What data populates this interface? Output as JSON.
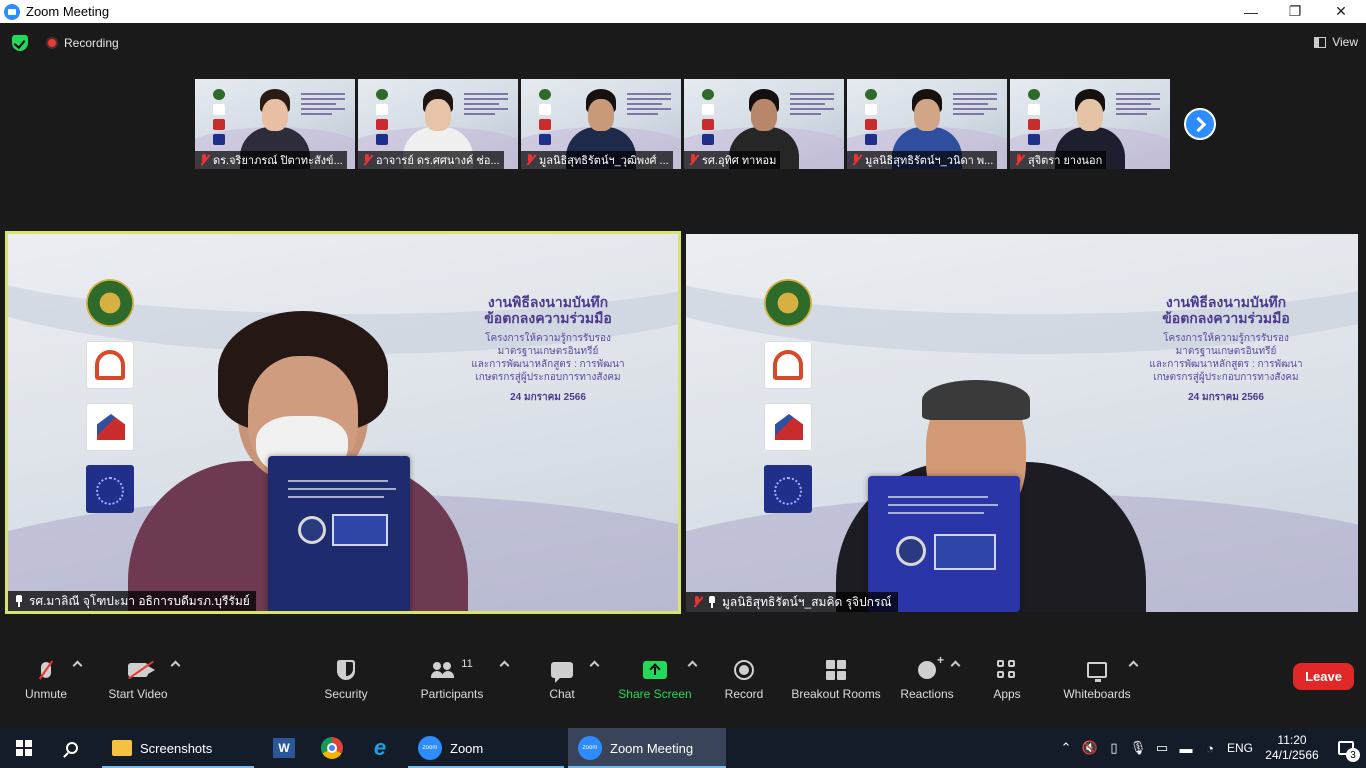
{
  "window": {
    "title": "Zoom Meeting",
    "minimize": "—",
    "maximize": "❐",
    "close": "✕"
  },
  "topbar": {
    "recording_label": "Recording",
    "view_label": "View"
  },
  "thumbnails": [
    {
      "name": "ดร.จริยาภรณ์ ปิตาทะสังข์...",
      "skin": "#e8bfa2",
      "hair": "#2a1b14",
      "shirt": "#2c2c3a"
    },
    {
      "name": "อาจารย์ ดร.ศศนางค์ ช่อ...",
      "skin": "#e7c3a8",
      "hair": "#1d1512",
      "shirt": "#f0f0f0"
    },
    {
      "name": "มูลนิธิสุทธิรัตน์ฯ_วุฒิพงศ์ ...",
      "skin": "#c99a7a",
      "hair": "#161010",
      "shirt": "#1e2a4a"
    },
    {
      "name": "รศ.อุทิศ ทาหอม",
      "skin": "#b8876a",
      "hair": "#141010",
      "shirt": "#262626"
    },
    {
      "name": "มูลนิธิสุทธิรัตน์ฯ_วนิดา พ...",
      "skin": "#d1a687",
      "hair": "#16110f",
      "shirt": "#2f4ea0"
    },
    {
      "name": "สุจิตรา  ยางนอก",
      "skin": "#e5c3a5",
      "hair": "#141010",
      "shirt": "#1d1f2e"
    }
  ],
  "main_videos": [
    {
      "name": "รศ.มาลิณี จุโฑปะมา อธิการบดีมรภ.บุรีรัมย์",
      "active": true,
      "muted": false
    },
    {
      "name": "มูลนิธิสุทธิรัตน์ฯ_สมคิด รุจิปกรณ์",
      "active": false,
      "muted": true
    }
  ],
  "slide": {
    "title_line1": "งานพิธีลงนามบันทึก",
    "title_line2": "ข้อตกลงความร่วมมือ",
    "body_line1": "โครงการให้ความรู้การรับรอง",
    "body_line2": "มาตรฐานเกษตรอินทรีย์",
    "body_line3": "และการพัฒนาหลักสูตร : การพัฒนา",
    "body_line4": "เกษตรกรสู่ผู้ประกอบการทางสังคม",
    "date": "24 มกราคม 2566"
  },
  "toolbar": {
    "unmute": "Unmute",
    "start_video": "Start Video",
    "security": "Security",
    "participants": "Participants",
    "participants_count": "11",
    "chat": "Chat",
    "share_screen": "Share Screen",
    "record": "Record",
    "breakout_rooms": "Breakout Rooms",
    "reactions": "Reactions",
    "apps": "Apps",
    "whiteboards": "Whiteboards",
    "leave": "Leave"
  },
  "taskbar": {
    "apps": [
      {
        "label": "Screenshots",
        "icon": "folder-icon"
      },
      {
        "label": "",
        "icon": "word-icon"
      },
      {
        "label": "",
        "icon": "chrome-icon"
      },
      {
        "label": "",
        "icon": "ie-icon"
      },
      {
        "label": "Zoom",
        "icon": "zoom-icon"
      },
      {
        "label": "Zoom Meeting",
        "icon": "zoom-icon"
      }
    ],
    "word_letter": "W",
    "ie_letter": "e",
    "zoom_icon_text": "zoom",
    "language": "ENG",
    "time": "11:20",
    "date": "24/1/2566",
    "notification_count": "3"
  }
}
